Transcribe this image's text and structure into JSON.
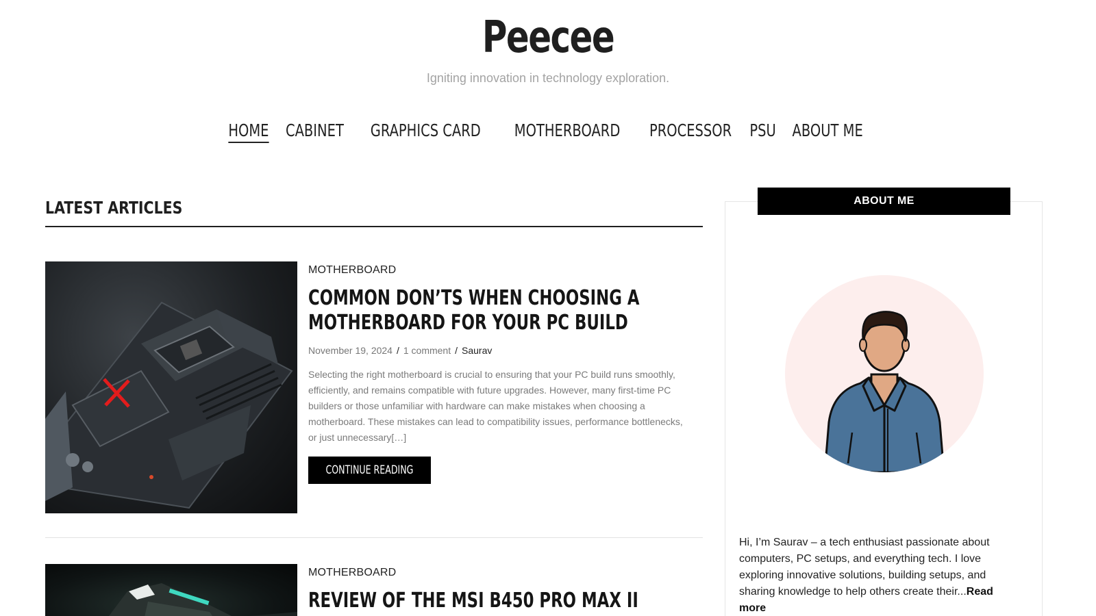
{
  "site": {
    "title": "Peecee",
    "tagline": "Igniting innovation in technology exploration."
  },
  "nav": {
    "items": [
      {
        "label": "HOME",
        "active": true
      },
      {
        "label": "CABINET"
      },
      {
        "label": "GRAPHICS CARD"
      },
      {
        "label": "MOTHERBOARD"
      },
      {
        "label": "PROCESSOR"
      },
      {
        "label": "PSU"
      },
      {
        "label": "ABOUT ME"
      }
    ]
  },
  "main": {
    "section_title": "LATEST ARTICLES",
    "posts": [
      {
        "category": "MOTHERBOARD",
        "title": "COMMON DON’TS WHEN CHOOSING A MOTHERBOARD FOR YOUR PC BUILD",
        "date": "November 19, 2024",
        "comments": "1 comment",
        "author": "Saurav",
        "excerpt": "Selecting the right motherboard is crucial to ensuring that your PC build runs smoothly, efficiently, and remains compatible with future upgrades. However, many first-time PC builders or those unfamiliar with hardware can make mistakes when choosing a motherboard. These mistakes can lead to compatibility issues, performance bottlenecks, or just unnecessary[…]",
        "button": "CONTINUE READING"
      },
      {
        "category": "MOTHERBOARD",
        "title": "REVIEW OF THE MSI B450 PRO MAX II"
      }
    ]
  },
  "sidebar": {
    "widget_title": "ABOUT ME",
    "about_text": "Hi, I’m Saurav – a tech enthusiast passionate about computers, PC setups, and everything tech. I love exploring innovative solutions, building setups, and sharing knowledge to help others create their...",
    "read_more": "Read more"
  },
  "colors": {
    "accent": "#000000",
    "tagline": "#a3a3a3",
    "avatar_bg": "#fdeeed",
    "shirt": "#4a7399"
  }
}
